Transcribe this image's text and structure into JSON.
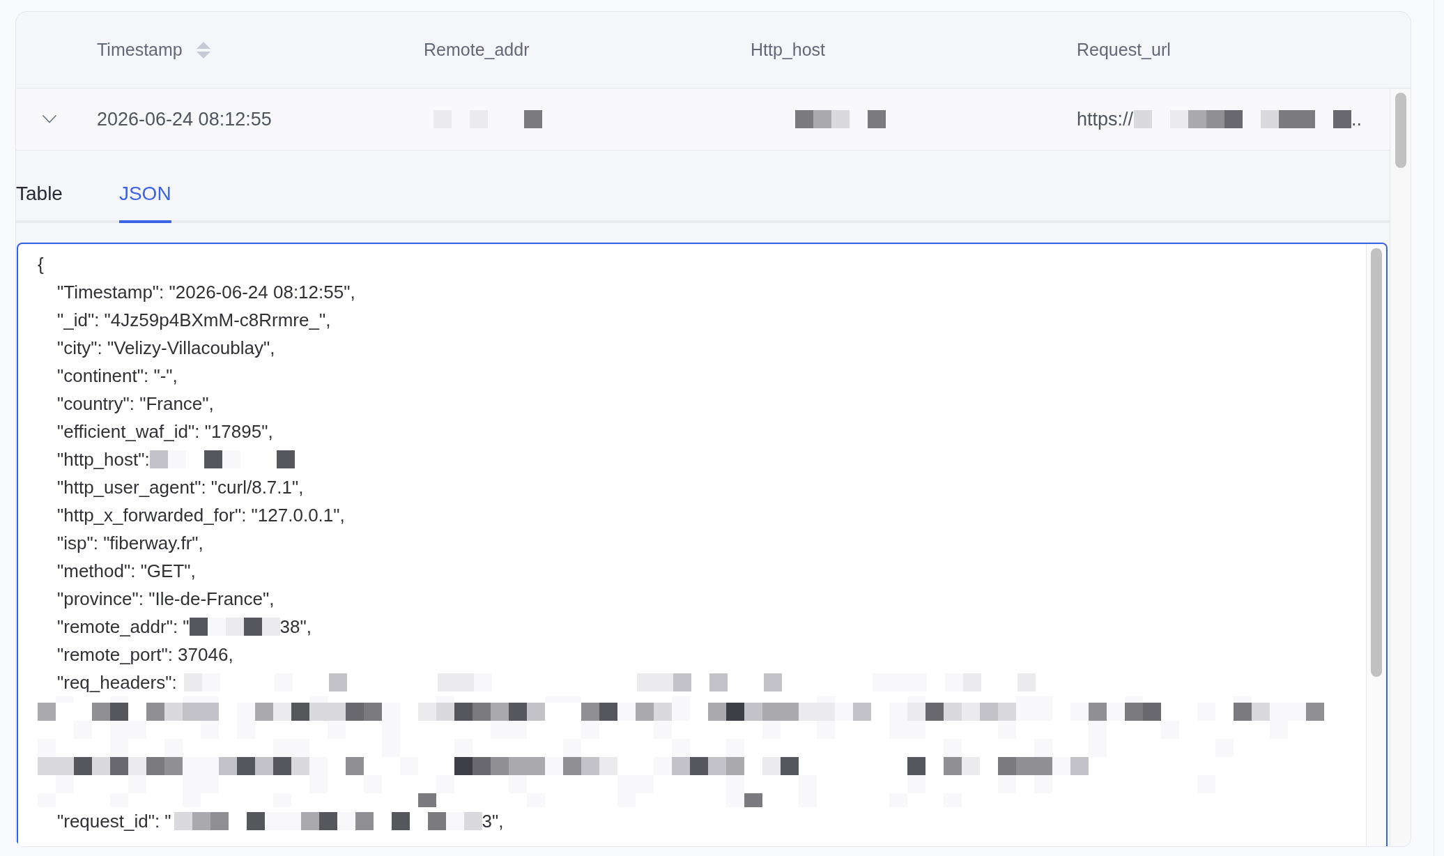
{
  "table": {
    "columns": [
      {
        "label": "Timestamp",
        "sortable": true
      },
      {
        "label": "Remote_addr",
        "sortable": false
      },
      {
        "label": "Http_host",
        "sortable": false
      },
      {
        "label": "Request_url",
        "sortable": false
      }
    ],
    "rows": [
      {
        "expanded": true,
        "cells": [
          {
            "kind": "text",
            "text": "2026-06-24 08:12:55"
          },
          {
            "kind": "redacted"
          },
          {
            "kind": "redacted"
          },
          {
            "kind": "partly_redacted",
            "text": "https://",
            "after": ".."
          }
        ]
      }
    ]
  },
  "detail": {
    "tabs": [
      {
        "label": "Table",
        "selected": false
      },
      {
        "label": "JSON",
        "selected": true
      }
    ],
    "json_view": {
      "open": "{",
      "children": [
        {
          "kind": "text",
          "text": "\"Timestamp\": \"2026-06-24 08:12:55\","
        },
        {
          "kind": "text",
          "text": "\"_id\": \"4Jz59p4BXmM-c8Rrmre_\","
        },
        {
          "kind": "text",
          "text": "\"city\": \"Velizy-Villacoublay\","
        },
        {
          "kind": "text",
          "text": "\"continent\": \"-\","
        },
        {
          "kind": "text",
          "text": "\"country\": \"France\","
        },
        {
          "kind": "text",
          "text": "\"efficient_waf_id\": \"17895\","
        },
        {
          "kind": "masked",
          "text": "\"http_host\":"
        },
        {
          "kind": "text",
          "text": "\"http_user_agent\": \"curl/8.7.1\","
        },
        {
          "kind": "text",
          "text": "\"http_x_forwarded_for\": \"127.0.0.1\","
        },
        {
          "kind": "text",
          "text": "\"isp\": \"fiberway.fr\","
        },
        {
          "kind": "text",
          "text": "\"method\": \"GET\","
        },
        {
          "kind": "text",
          "text": "\"province\": \"Ile-de-France\","
        },
        {
          "kind": "masked",
          "text": "\"remote_addr\": \"",
          "after": "38\","
        },
        {
          "kind": "text",
          "text": "\"remote_port\": 37046,"
        },
        {
          "kind": "masked",
          "text": "\"req_headers\":"
        },
        {
          "kind": "redacted"
        },
        {
          "kind": "masked",
          "text": "\"request_id\": \"",
          "after": "3\","
        }
      ]
    }
  }
}
